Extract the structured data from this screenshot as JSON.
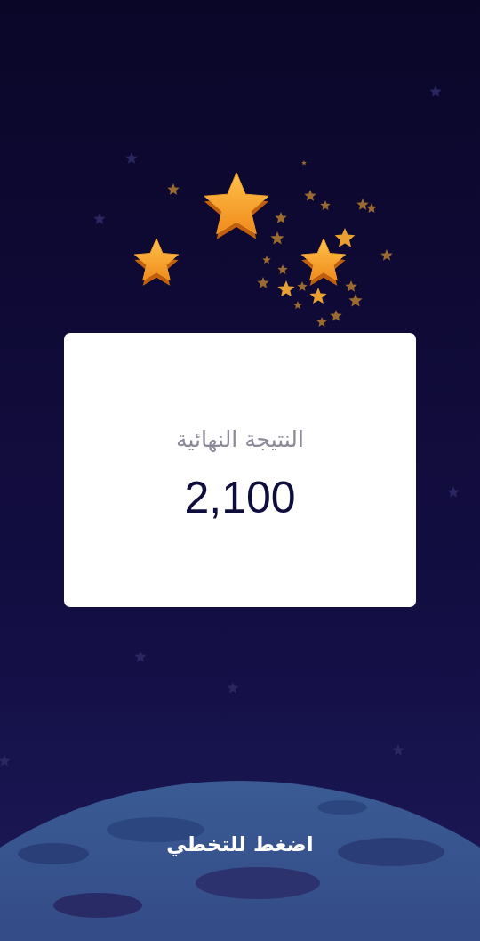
{
  "result_card": {
    "title": "النتيجة النهائية",
    "score": "2,100"
  },
  "skip_prompt": "اضغط للتخطي"
}
